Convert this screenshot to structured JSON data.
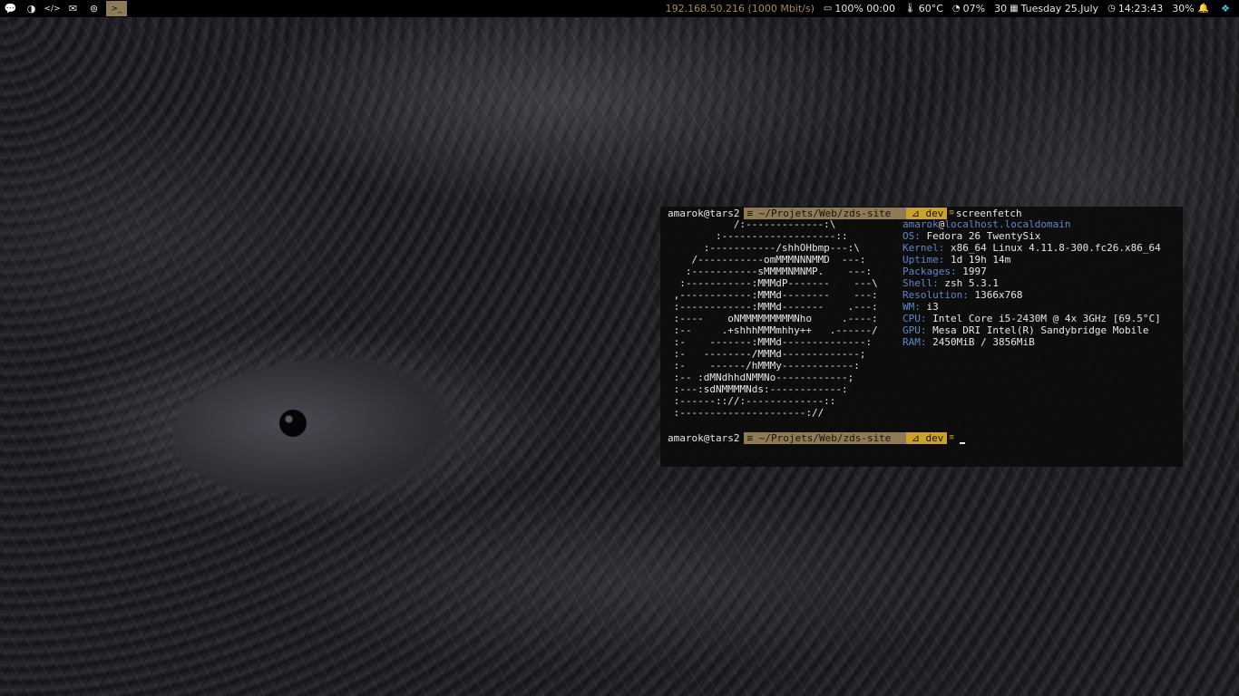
{
  "topbar": {
    "workspaces": [
      {
        "icon": "wechat-icon",
        "glyph": "✉"
      },
      {
        "icon": "firefox-icon",
        "glyph": "◑"
      },
      {
        "icon": "code-icon",
        "glyph": "</>"
      },
      {
        "icon": "mail-icon",
        "glyph": "✉"
      },
      {
        "icon": "gamepad-icon",
        "glyph": "⊚"
      },
      {
        "icon": "terminal-icon",
        "glyph": ">_"
      }
    ],
    "active_workspace": 5,
    "ip": "192.168.50.216 (1000 Mbit/s)",
    "battery": "100% 00:00",
    "temperature": "60°C",
    "cpu": "07%",
    "date_num": "30",
    "date": "Tuesday 25.July",
    "time": "14:23:43",
    "volume": "30%"
  },
  "terminal": {
    "prompt_user": "amarok@tars2",
    "prompt_path": "~/Projets/Web/zds-site",
    "prompt_branch": "dev",
    "command": "screenfetch",
    "ascii_art": [
      "           /:-------------:\\",
      "        :-------------------::",
      "      :-----------/shhOHbmp---:\\",
      "    /-----------omMMMNNNMMD  ---:",
      "   :-----------sMMMMNMNMP.    ---:",
      "  :-----------:MMMdP-------    ---\\",
      " ,------------:MMMd--------    ---:",
      " :------------:MMMd-------    .---:",
      " :----    oNMMMMMMMMMNho     .----:",
      " :--     .+shhhMMMmhhy++   .------/",
      " :-    -------:MMMd--------------:",
      " :-   --------/MMMd-------------;",
      " :-    ------/hMMMy------------:",
      " :-- :dMNdhhdNMMNo------------;",
      " :---:sdNMMMMNds:------------:",
      " :------:://:-------------::",
      " :---------------------://"
    ],
    "info_user": "amarok",
    "info_host": "localhost.localdomain",
    "info": [
      {
        "key": "OS:",
        "value": "Fedora 26 TwentySix"
      },
      {
        "key": "Kernel:",
        "value": "x86_64 Linux 4.11.8-300.fc26.x86_64"
      },
      {
        "key": "Uptime:",
        "value": "1d 19h 14m"
      },
      {
        "key": "Packages:",
        "value": "1997"
      },
      {
        "key": "Shell:",
        "value": "zsh 5.3.1"
      },
      {
        "key": "Resolution:",
        "value": "1366x768"
      },
      {
        "key": "WM:",
        "value": "i3"
      },
      {
        "key": "CPU:",
        "value": "Intel Core i5-2430M @ 4x 3GHz [69.5°C]"
      },
      {
        "key": "GPU:",
        "value": "Mesa DRI Intel(R) Sandybridge Mobile"
      },
      {
        "key": "RAM:",
        "value": "2450MiB / 3856MiB"
      }
    ]
  }
}
